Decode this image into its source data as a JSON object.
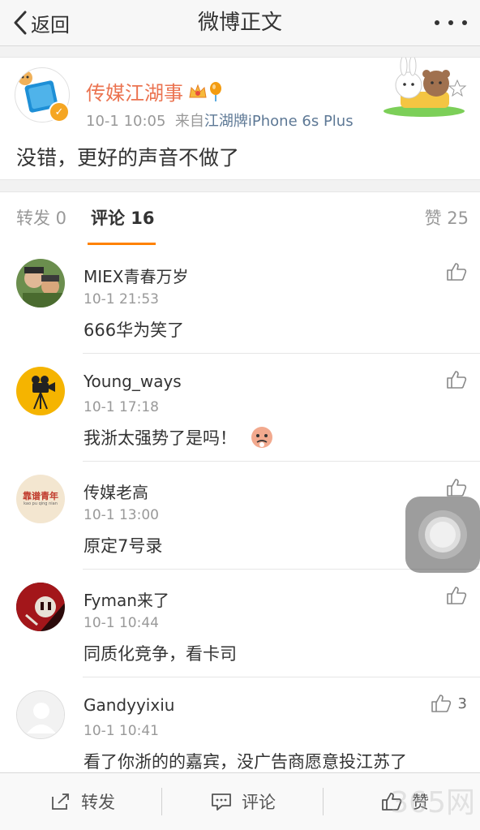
{
  "nav": {
    "back_label": "返回",
    "title": "微博正文"
  },
  "post": {
    "author": "传媒江湖事",
    "time": "10-1 10:05",
    "source_prefix": "来自",
    "source": "江湖牌iPhone 6s Plus",
    "text": "没错，更好的声音不做了"
  },
  "tabs": {
    "repost": "转发 0",
    "comment": "评论 16",
    "like": "赞 25"
  },
  "comments": [
    {
      "name": "MIEX青春万岁",
      "time": "10-1 21:53",
      "text": "666华为笑了",
      "likes": ""
    },
    {
      "name": "Young_ways",
      "time": "10-1 17:18",
      "text": "我浙太强势了是吗！",
      "likes": ""
    },
    {
      "name": "传媒老高",
      "time": "10-1 13:00",
      "text": "原定7号录",
      "likes": "",
      "avatar_text": "靠谱青年",
      "avatar_sub": "kao pu qing nian"
    },
    {
      "name": "Fyman来了",
      "time": "10-1 10:44",
      "text": "同质化竞争，看卡司",
      "likes": ""
    },
    {
      "name": "Gandyyixiu",
      "time": "10-1 10:41",
      "text": "看了你浙的的嘉宾，没广告商愿意投江苏了",
      "likes": "3"
    }
  ],
  "bottom": {
    "repost": "转发",
    "comment": "评论",
    "like": "赞"
  },
  "watermark": "365网"
}
